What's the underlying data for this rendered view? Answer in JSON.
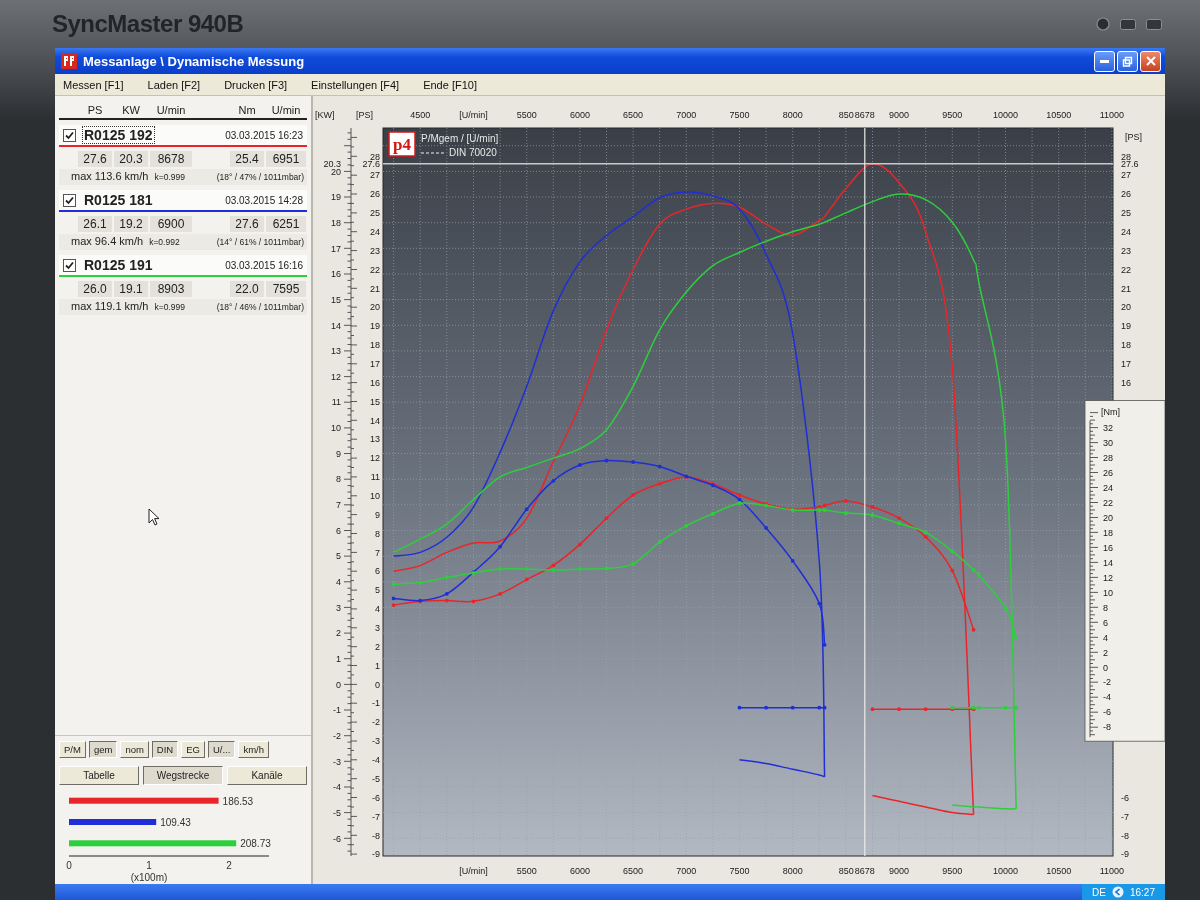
{
  "monitor": {
    "brand": "SyncMaster 940B"
  },
  "window": {
    "title": "Messanlage \\ Dynamische Messung"
  },
  "menu": [
    "Messen [F1]",
    "Laden [F2]",
    "Drucken [F3]",
    "Einstellungen [F4]",
    "Ende [F10]"
  ],
  "panel": {
    "columns": [
      "PS",
      "KW",
      "U/min",
      "Nm",
      "U/min"
    ],
    "runs": [
      {
        "name": "R0125 192",
        "selected": true,
        "checked": true,
        "color": "#e8262a",
        "date": "03.03.2015 16:23",
        "values": [
          "27.6",
          "20.3",
          "8678",
          "25.4",
          "6951"
        ],
        "max_speed": "max 113.6 km/h",
        "k": "k=0.999",
        "conditions": "(18° / 47% / 1011mbar)"
      },
      {
        "name": "R0125 181",
        "selected": false,
        "checked": true,
        "color": "#1f2ed6",
        "date": "03.03.2015 14:28",
        "values": [
          "26.1",
          "19.2",
          "6900",
          "27.6",
          "6251"
        ],
        "max_speed": "max 96.4 km/h",
        "k": "k=0.992",
        "conditions": "(14° / 61% / 1011mbar)"
      },
      {
        "name": "R0125 191",
        "selected": false,
        "checked": true,
        "color": "#2ccf3c",
        "date": "03.03.2015 16:16",
        "values": [
          "26.0",
          "19.1",
          "8903",
          "22.0",
          "7595"
        ],
        "max_speed": "max 119.1 km/h",
        "k": "k=0.999",
        "conditions": "(18° / 46% / 1011mbar)"
      }
    ],
    "toggles": [
      {
        "label": "P/M",
        "selected": false
      },
      {
        "label": "gem",
        "selected": true
      },
      {
        "label": "nom",
        "selected": false
      },
      {
        "label": "DIN",
        "selected": true
      },
      {
        "label": "EG",
        "selected": false
      },
      {
        "label": "U/...",
        "selected": true
      },
      {
        "label": "km/h",
        "selected": false
      }
    ],
    "tabs": [
      {
        "label": "Tabelle",
        "selected": false
      },
      {
        "label": "Wegstrecke",
        "selected": true
      },
      {
        "label": "Kanäle",
        "selected": false
      }
    ],
    "distance_chart": {
      "chart_data": {
        "type": "bar",
        "orientation": "horizontal",
        "stacked": true,
        "categories": [
          null,
          null,
          null
        ],
        "xlabel": "(x100m)",
        "xlim": [
          0,
          2.5
        ],
        "xticks": [
          0,
          1,
          2
        ],
        "value_labels": [
          "186.53",
          "109.43",
          "208.73"
        ],
        "series": [
          {
            "color": "#e8262a",
            "values": [
              1.87,
              null,
              null
            ]
          },
          {
            "color": "#1f2ed6",
            "values": [
              null,
              1.09,
              null
            ]
          },
          {
            "color": "#2ccf3c",
            "values": [
              null,
              null,
              2.09
            ]
          }
        ]
      }
    }
  },
  "chart": {
    "logo": "p4",
    "standard": "DIN 70020",
    "top_fragment": "850",
    "bottom_fragment": "850",
    "right_axis": {
      "label": "[PS]",
      "ticks": [
        "28",
        "27.6",
        "27",
        "26",
        "25",
        "24",
        "23",
        "22",
        "21",
        "20",
        "19",
        "18",
        "17",
        "16",
        "-6",
        "-7",
        "-8",
        "-9"
      ]
    },
    "chart_data": {
      "type": "line",
      "title": "P/Mgem / [U/min]",
      "xlabel": "[U/min]",
      "ylabel": "[PS]",
      "y2label": "[Nm]",
      "y3label": "[KW]",
      "x2label": "[U/min]",
      "grid": true,
      "x": [
        4250,
        4500,
        4750,
        5000,
        5250,
        5500,
        5750,
        6000,
        6250,
        6500,
        6750,
        7000,
        7250,
        7500,
        7750,
        8000,
        8250,
        8300,
        8500,
        8750,
        9000,
        9250,
        9500,
        9700,
        9750,
        10000,
        10100
      ],
      "xlim": [
        4150,
        11010
      ],
      "x2lim": [
        4150,
        11010
      ],
      "ylim": [
        -9.1,
        29.5
      ],
      "y2lim": [
        -25.2,
        72.0
      ],
      "y3lim": [
        -6.69,
        21.69
      ],
      "xticks": [
        4500,
        5500,
        6000,
        6500,
        7000,
        7500,
        8000,
        8678,
        9000,
        9500,
        10000,
        10500,
        11000
      ],
      "x2ticks": [
        5500,
        6000,
        6500,
        7000,
        7500,
        8000,
        8678,
        9000,
        9500,
        10000,
        10500,
        11000
      ],
      "yticks": [
        -9,
        -8,
        -7,
        -6,
        -5,
        -4,
        -3,
        -2,
        -1,
        0,
        1,
        2,
        3,
        4,
        5,
        6,
        7,
        8,
        9,
        10,
        11,
        12,
        13,
        14,
        15,
        16,
        17,
        18,
        19,
        20,
        21,
        22,
        23,
        24,
        25,
        26,
        27,
        27.6,
        28
      ],
      "y3ticks": [
        -6,
        -5,
        -4,
        -3,
        -2,
        -1,
        0,
        1,
        2,
        3,
        4,
        5,
        6,
        7,
        8,
        9,
        10,
        11,
        12,
        13,
        14,
        15,
        16,
        17,
        18,
        19,
        20,
        20.3
      ],
      "y2ticks": [
        32,
        30,
        28,
        26,
        24,
        22,
        20,
        18,
        16,
        14,
        12,
        10,
        8,
        6,
        4,
        2,
        0,
        -2,
        -4,
        -6,
        -8
      ],
      "series": [
        {
          "color": "#e8262a",
          "values": [
            6.0,
            6.3,
            7.0,
            7.5,
            7.6,
            8.8,
            11.8,
            14.8,
            18.8,
            22.0,
            24.4,
            25.2,
            25.5,
            25.3,
            24.4,
            23.8,
            24.6,
            24.8,
            26.3,
            27.6,
            26.6,
            24.0,
            16.8,
            -6.9,
            null,
            null,
            null
          ]
        },
        {
          "color": "#1f2ed6",
          "values": [
            6.8,
            7.0,
            7.8,
            9.4,
            12.3,
            15.8,
            19.8,
            22.4,
            23.8,
            24.8,
            25.8,
            26.1,
            25.9,
            25.2,
            22.8,
            18.6,
            6.5,
            -4.9,
            null,
            null,
            null,
            null,
            null,
            null,
            null,
            null,
            null
          ]
        },
        {
          "color": "#2ccf3c",
          "values": [
            7.0,
            7.7,
            8.5,
            9.8,
            11.0,
            11.5,
            12.0,
            12.5,
            13.5,
            15.8,
            18.8,
            20.8,
            22.2,
            22.9,
            23.5,
            24.0,
            24.4,
            24.5,
            25.0,
            25.6,
            26.0,
            25.7,
            24.5,
            22.5,
            21.3,
            13.0,
            -6.6
          ]
        },
        {
          "color": "#e8262a",
          "axis": "y2",
          "values": [
            8.3,
            8.8,
            8.9,
            8.8,
            9.8,
            11.7,
            13.6,
            16.4,
            19.9,
            23.0,
            24.5,
            25.4,
            24.5,
            23.0,
            21.8,
            21.1,
            21.4,
            21.6,
            22.2,
            21.4,
            19.9,
            17.4,
            12.9,
            5.0,
            null,
            null,
            null
          ]
        },
        {
          "color": "#1f2ed6",
          "axis": "y2",
          "values": [
            9.2,
            8.9,
            9.8,
            12.7,
            16.1,
            21.1,
            24.9,
            27.0,
            27.6,
            27.4,
            26.8,
            25.5,
            24.3,
            22.4,
            18.6,
            14.2,
            8.5,
            3.0,
            null,
            null,
            null,
            null,
            null,
            null,
            null,
            null,
            null
          ]
        },
        {
          "color": "#2ccf3c",
          "axis": "y2",
          "values": [
            11.1,
            11.3,
            12.0,
            12.6,
            13.1,
            13.1,
            13.0,
            13.1,
            13.2,
            13.8,
            16.7,
            18.9,
            20.5,
            21.9,
            21.6,
            21.0,
            21.0,
            21.0,
            20.6,
            20.3,
            19.2,
            18.0,
            15.5,
            13.0,
            12.3,
            7.9,
            4.0
          ]
        },
        {
          "color": "#e8262a",
          "axis": "y2",
          "values": [
            null,
            null,
            null,
            null,
            null,
            null,
            null,
            null,
            null,
            null,
            null,
            null,
            null,
            null,
            null,
            null,
            null,
            null,
            null,
            -5.6,
            -5.6,
            -5.6,
            -5.6,
            -5.6,
            null,
            null,
            null
          ]
        },
        {
          "color": "#1f2ed6",
          "axis": "y2",
          "values": [
            null,
            null,
            null,
            null,
            null,
            null,
            null,
            null,
            null,
            null,
            null,
            null,
            null,
            -5.4,
            -5.4,
            -5.4,
            -5.4,
            -5.4,
            null,
            null,
            null,
            null,
            null,
            null,
            null,
            null,
            null
          ]
        },
        {
          "color": "#2ccf3c",
          "axis": "y2",
          "values": [
            null,
            null,
            null,
            null,
            null,
            null,
            null,
            null,
            null,
            null,
            null,
            null,
            null,
            null,
            null,
            null,
            null,
            null,
            null,
            null,
            null,
            null,
            -5.4,
            -5.4,
            -5.4,
            -5.4,
            -5.4
          ]
        },
        {
          "color": "#e8262a",
          "values": [
            null,
            null,
            null,
            null,
            null,
            null,
            null,
            null,
            null,
            null,
            null,
            null,
            null,
            null,
            null,
            null,
            null,
            null,
            null,
            -5.9,
            -6.2,
            -6.5,
            -6.8,
            -6.9,
            null,
            null,
            null
          ]
        },
        {
          "color": "#1f2ed6",
          "values": [
            null,
            null,
            null,
            null,
            null,
            null,
            null,
            null,
            null,
            null,
            null,
            null,
            null,
            -4.0,
            -4.2,
            -4.5,
            -4.8,
            -4.9,
            null,
            null,
            null,
            null,
            null,
            null,
            null,
            null,
            null
          ]
        },
        {
          "color": "#2ccf3c",
          "values": [
            null,
            null,
            null,
            null,
            null,
            null,
            null,
            null,
            null,
            null,
            null,
            null,
            null,
            null,
            null,
            null,
            null,
            null,
            null,
            null,
            null,
            null,
            -6.4,
            -6.5,
            -6.5,
            -6.6,
            -6.6
          ]
        }
      ],
      "ref_lines": [
        {
          "axis": "x",
          "value": 8678
        },
        {
          "axis": "y",
          "value": 27.6
        }
      ]
    }
  },
  "taskbar": {
    "language": "DE",
    "clock": "16:27"
  }
}
